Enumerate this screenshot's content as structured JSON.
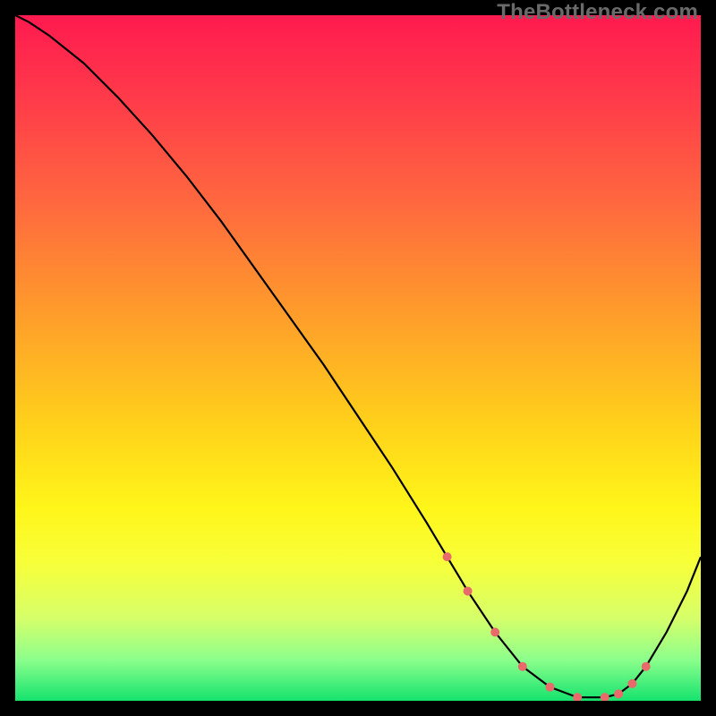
{
  "attribution": "TheBottleneck.com",
  "colors": {
    "marker": "#e86a6a",
    "curve": "#000000"
  },
  "chart_data": {
    "type": "line",
    "title": "",
    "xlabel": "",
    "ylabel": "",
    "xlim": [
      0,
      100
    ],
    "ylim": [
      0,
      100
    ],
    "x": [
      0,
      2,
      5,
      10,
      15,
      20,
      25,
      30,
      35,
      40,
      45,
      50,
      55,
      60,
      63,
      66,
      70,
      74,
      78,
      82,
      86,
      88,
      90,
      92,
      95,
      98,
      100
    ],
    "y": [
      100,
      99,
      97,
      93,
      88,
      82.5,
      76.5,
      70,
      63,
      56,
      49,
      41.5,
      34,
      26,
      21,
      16,
      10,
      5,
      2,
      0.5,
      0.5,
      1,
      2.5,
      5,
      10,
      16,
      21
    ],
    "markers_x": [
      63,
      66,
      70,
      74,
      78,
      82,
      86,
      88,
      90,
      92
    ],
    "markers_y": [
      21,
      16,
      10,
      5,
      2,
      0.5,
      0.5,
      1,
      2.5,
      5
    ],
    "marker_radius": 5
  }
}
